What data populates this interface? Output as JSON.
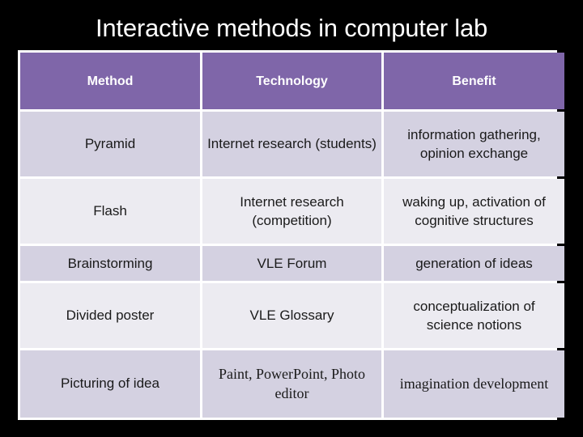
{
  "slide": {
    "title": "Interactive methods in computer lab",
    "background_color": "#000000",
    "title_color": "#ffffff"
  },
  "table": {
    "header_color": "#7f66a9",
    "row_shade_color": "#d4d1e1",
    "row_light_color": "#ecebf1",
    "columns": [
      "Method",
      "Technology",
      "Benefit"
    ],
    "rows": [
      {
        "method": "Pyramid",
        "technology": "Internet research (students)",
        "benefit": "information gathering, opinion exchange"
      },
      {
        "method": "Flash",
        "technology": "Internet research (competition)",
        "benefit": "waking up, activation of cognitive structures"
      },
      {
        "method": "Brainstorming",
        "technology": "VLE Forum",
        "benefit": "generation of ideas"
      },
      {
        "method": "Divided poster",
        "technology": "VLE Glossary",
        "benefit": "conceptualization of science notions"
      },
      {
        "method": "Picturing of idea",
        "technology": "Paint, PowerPoint, Photo editor",
        "benefit": "imagination development"
      }
    ]
  }
}
